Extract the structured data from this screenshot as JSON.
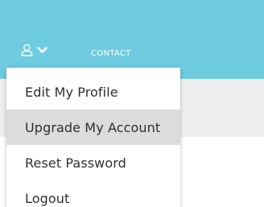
{
  "header": {
    "background_color": "#6ecbe0",
    "user_icon": "user-icon",
    "chevron_icon": "chevron-down-icon",
    "contact_label": "CONTACT"
  },
  "user_menu": {
    "items": [
      {
        "label": "Edit My Profile",
        "highlighted": false
      },
      {
        "label": "Upgrade My Account",
        "highlighted": true
      },
      {
        "label": "Reset Password",
        "highlighted": false
      },
      {
        "label": "Logout",
        "highlighted": false
      }
    ],
    "highlight_color": "#dcdcdc"
  }
}
